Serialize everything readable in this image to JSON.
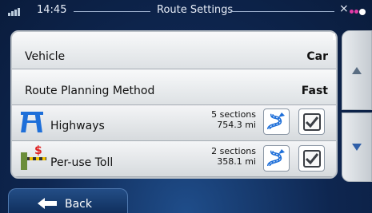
{
  "status_bar": {
    "time": "14:45",
    "title": "Route Settings"
  },
  "settings": {
    "vehicle": {
      "label": "Vehicle",
      "value": "Car"
    },
    "route_planning": {
      "label": "Route Planning Method",
      "value": "Fast"
    },
    "highways": {
      "label": "Highways",
      "sections": "5 sections",
      "distance": "754.3 mi",
      "checked": true
    },
    "toll": {
      "label": "Per-use Toll",
      "sections": "2 sections",
      "distance": "358.1 mi",
      "checked": true
    }
  },
  "footer": {
    "back_label": "Back"
  },
  "icons": {
    "signal": "signal-icon",
    "satellite": "satellite-icon",
    "highway": "highway-icon",
    "toll": "toll-icon",
    "route": "route-icon",
    "check": "check-icon",
    "up": "up-arrow-icon",
    "down": "down-arrow-icon",
    "back": "back-arrow-icon"
  },
  "colors": {
    "background": "#0e2650",
    "accent_blue": "#1e6fd9",
    "toll_red": "#e02020"
  }
}
